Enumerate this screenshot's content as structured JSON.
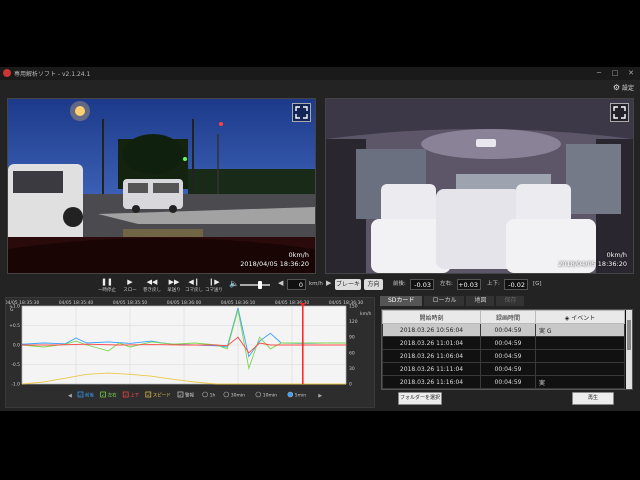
{
  "app": {
    "title": "専用解析ソフト - v2.1.24.1",
    "settings_label": "設定"
  },
  "videos": [
    {
      "speed": "0km/h",
      "timestamp": "2018/04/05 18:36:20"
    },
    {
      "speed": "0km/h",
      "timestamp": "2018/04/05 18:36:20"
    }
  ],
  "controls": {
    "buttons": [
      "一時停止",
      "スロー",
      "巻き戻し",
      "早送り",
      "コマ戻し",
      "コマ送り"
    ],
    "speed_value": "0",
    "speed_unit": "km/h",
    "brake_label": "ブレーキ",
    "turn_label": "方向",
    "front_back_label": "前後:",
    "front_back_value": "-0.03",
    "left_right_label": "左右:",
    "left_right_value": "+0.03",
    "up_down_label": "上下:",
    "up_down_value": "-0.02",
    "g_unit": "[G]"
  },
  "chart_data": {
    "type": "line",
    "x_ticks": [
      "04/05 18:35:30",
      "04/05 18:35:40",
      "04/05 18:35:50",
      "04/05 18:36:00",
      "04/05 18:36:10",
      "04/05 18:36:20",
      "04/05 18:36:30"
    ],
    "y_left_ticks": [
      "+1.0",
      "+0.5",
      "0.0",
      "-0.5",
      "-1.0"
    ],
    "y_left_label": "G",
    "y_right_ticks": [
      "150",
      "120",
      "90",
      "60",
      "30",
      "0"
    ],
    "y_right_label": "km/h",
    "ylim_left": [
      -1.0,
      1.0
    ],
    "ylim_right": [
      0,
      150
    ],
    "xlim": [
      0,
      60
    ],
    "cursor_x": 52,
    "series": [
      {
        "name": "前後",
        "color": "#3aa0ff",
        "x": [
          0,
          4,
          8,
          10,
          12,
          16,
          20,
          24,
          26,
          28,
          32,
          36,
          38,
          40,
          42,
          44,
          46,
          48,
          52,
          56,
          60
        ],
        "y": [
          0.02,
          0.05,
          0.03,
          0.18,
          0.05,
          0.08,
          0.04,
          0.1,
          0.05,
          0.02,
          0.0,
          -0.02,
          -0.05,
          0.95,
          -0.3,
          0.1,
          0.3,
          0.05,
          0.04,
          0.05,
          0.05
        ]
      },
      {
        "name": "左右",
        "color": "#7bd64c",
        "x": [
          0,
          4,
          8,
          10,
          12,
          16,
          18,
          20,
          24,
          28,
          32,
          36,
          38,
          40,
          42,
          44,
          46,
          48,
          52,
          56,
          60
        ],
        "y": [
          0.0,
          -0.05,
          0.02,
          0.1,
          0.0,
          -0.15,
          0.05,
          -0.05,
          0.08,
          0.02,
          0.05,
          0.0,
          -0.1,
          0.9,
          -0.6,
          0.2,
          -0.1,
          0.05,
          0.05,
          0.05,
          0.05
        ]
      },
      {
        "name": "上下",
        "color": "#ff4848",
        "x": [
          0,
          6,
          12,
          18,
          24,
          30,
          36,
          38,
          40,
          42,
          44,
          46,
          48,
          52,
          56,
          60
        ],
        "y": [
          0.0,
          0.0,
          0.02,
          0.0,
          0.01,
          0.0,
          0.0,
          -0.02,
          0.2,
          -0.2,
          0.05,
          0.0,
          0.0,
          0.0,
          0.0,
          0.0
        ]
      },
      {
        "name": "スピード",
        "color": "#e8c84a",
        "x": [
          0,
          4,
          8,
          12,
          16,
          20,
          24,
          28,
          32,
          36,
          40,
          42,
          44,
          48,
          52,
          56,
          60
        ],
        "y": [
          -1.0,
          -0.95,
          -0.85,
          -0.75,
          -0.72,
          -0.75,
          -0.8,
          -0.88,
          -0.95,
          -1.0,
          -1.0,
          -1.0,
          -1.0,
          -1.0,
          -1.0,
          -1.0,
          -1.0
        ]
      }
    ],
    "legend": [
      {
        "label": "前後",
        "color": "#3aa0ff"
      },
      {
        "label": "左右",
        "color": "#7bd64c"
      },
      {
        "label": "上下",
        "color": "#ff4848"
      },
      {
        "label": "スピード",
        "color": "#e8c84a"
      },
      {
        "label": "警報",
        "color": "#cccccc"
      }
    ],
    "ranges": [
      "1h",
      "30min",
      "10min",
      "5min"
    ],
    "selected_range": "5min"
  },
  "tabs": [
    {
      "label": "SDカード",
      "active": true
    },
    {
      "label": "ローカル",
      "active": false
    },
    {
      "label": "地図",
      "active": false
    },
    {
      "label": "保存",
      "active": false,
      "disabled": true
    }
  ],
  "events": {
    "columns": [
      "開始時刻",
      "録画時間",
      "イベント"
    ],
    "rows": [
      {
        "start": "2018.03.26 10:56:04",
        "duration": "00:04:59",
        "event": "実 G",
        "selected": true
      },
      {
        "start": "2018.03.26 11:01:04",
        "duration": "00:04:59",
        "event": ""
      },
      {
        "start": "2018.03.26 11:06:04",
        "duration": "00:04:59",
        "event": ""
      },
      {
        "start": "2018.03.26 11:11:04",
        "duration": "00:04:59",
        "event": ""
      },
      {
        "start": "2018.03.26 11:16:04",
        "duration": "00:04:59",
        "event": "実"
      }
    ],
    "folder_button": "フォルダーを選択",
    "play_button": "再生"
  }
}
